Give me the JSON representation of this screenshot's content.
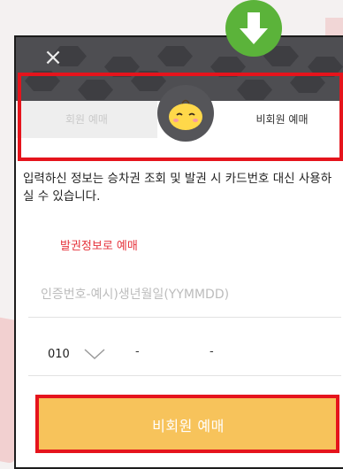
{
  "modal": {
    "close_symbol": "×",
    "tabs": {
      "member_label": "회원 예매",
      "nonmember_label": "비회원 예매"
    },
    "description": "입력하신 정보는 승차권 조회 및 발권 시 카드번호 대신 사용하실 수 있습니다.",
    "ticket_info_link": "발권정보로 예매",
    "auth_field": {
      "placeholder": "인증번호-예시)생년월일(YYMMDD)",
      "value": ""
    },
    "phone": {
      "prefix": "010",
      "separator": "-"
    },
    "submit_label": "비회원 예매"
  },
  "colors": {
    "header_bg": "#4e4e52",
    "highlight": "#e5141c",
    "arrow": "#5bb33a",
    "submit_bg": "#f7c35b",
    "link_red": "#e5323a"
  },
  "icons": {
    "close": "close-icon",
    "mascot": "mascot-icon",
    "arrow": "down-arrow-icon",
    "chevron": "chevron-down-icon"
  }
}
